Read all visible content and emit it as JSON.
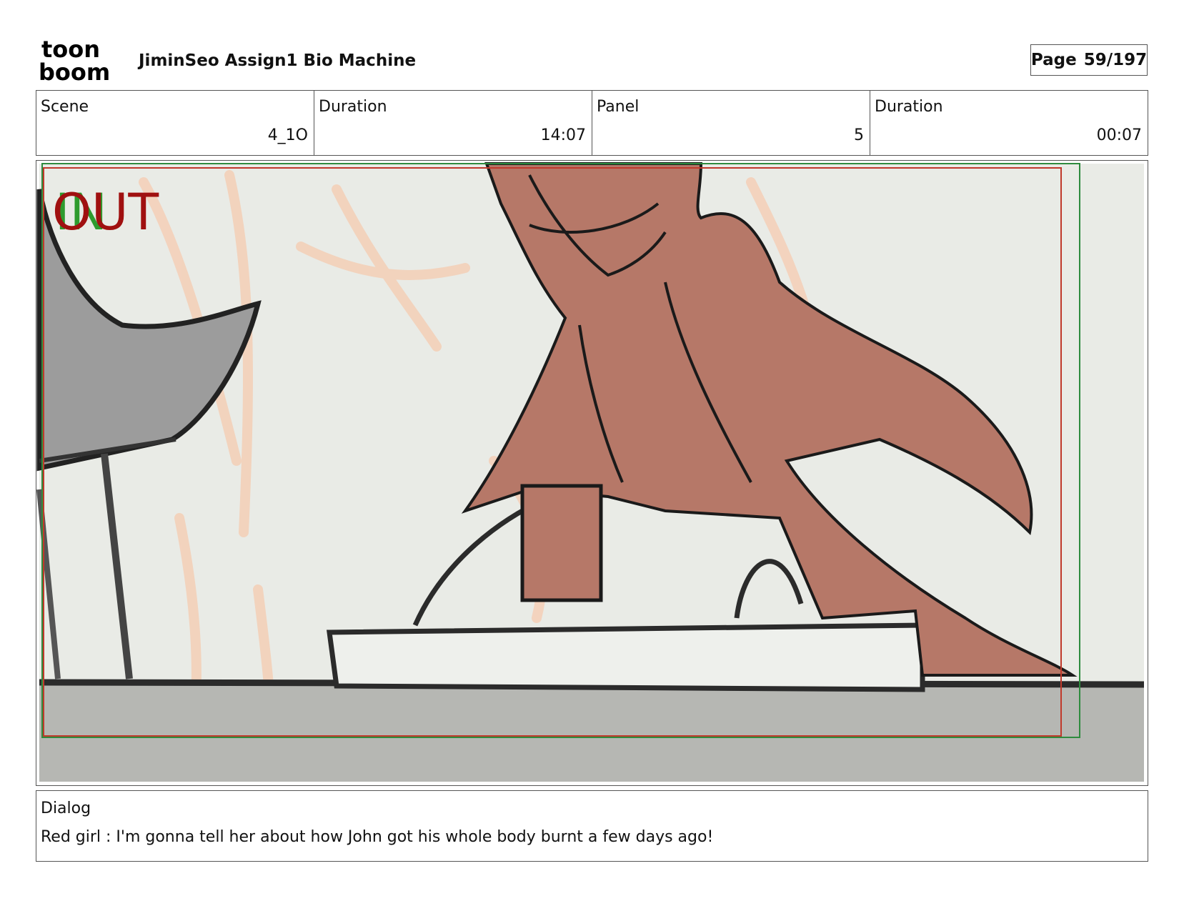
{
  "header": {
    "logo_text_top": "toon",
    "logo_text_bottom": "boom",
    "project_title": "JiminSeo Assign1 Bio Machine",
    "page_label": "Page",
    "page_number": "59/197"
  },
  "info": {
    "scene_label": "Scene",
    "scene_value": "4_1O",
    "scene_duration_label": "Duration",
    "scene_duration_value": "14:07",
    "panel_label": "Panel",
    "panel_value": "5",
    "panel_duration_label": "Duration",
    "panel_duration_value": "00:07"
  },
  "panel": {
    "in_marker": "IN",
    "out_marker": "OUT",
    "colors": {
      "background": "#e9ebe6",
      "character": "#b67868",
      "floor": "#b6b7b3",
      "chair": "#9c9c9c",
      "in_marker": "#2e9b2e",
      "out_marker": "#a01010",
      "safe_frame": "#c0392b",
      "field_frame": "#2e8b3e"
    }
  },
  "dialog": {
    "label": "Dialog",
    "text": "Red girl : I'm gonna tell her about how John got his whole body burnt a few days ago!"
  }
}
